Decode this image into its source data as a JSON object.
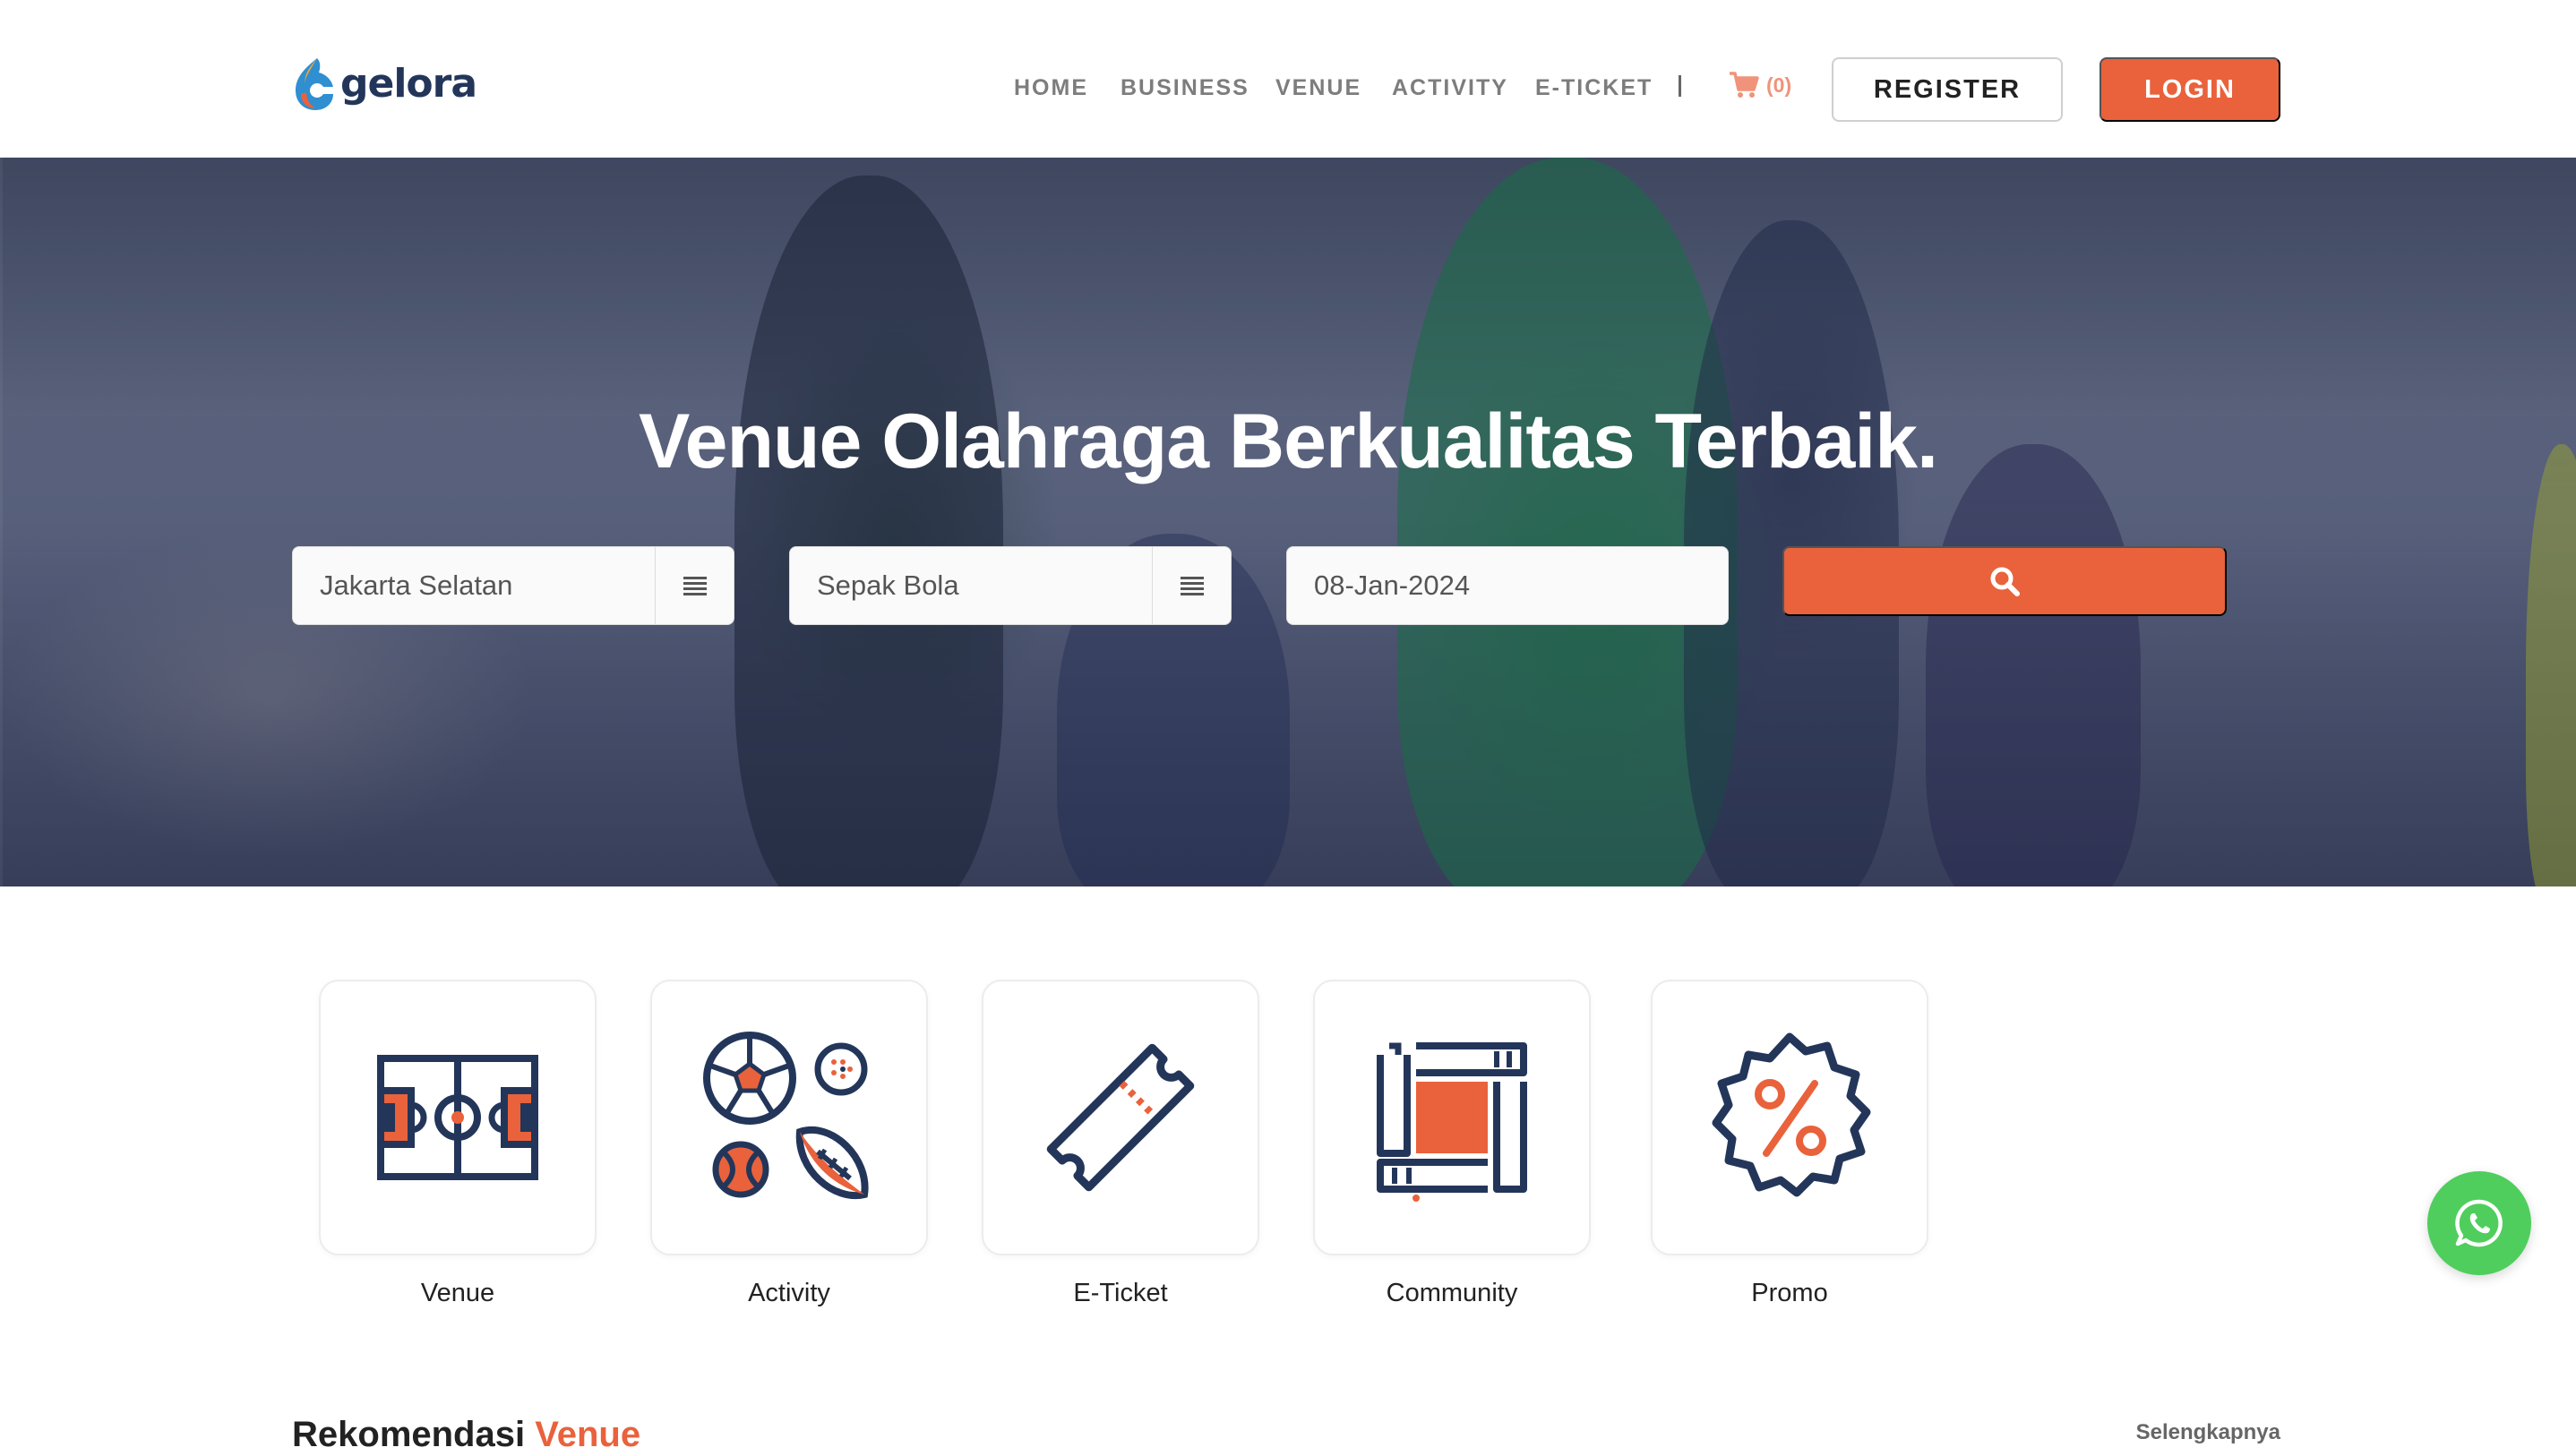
{
  "brand": {
    "name": "gelora",
    "accent": "#e9623c",
    "navy": "#23365a"
  },
  "nav": {
    "items": [
      "HOME",
      "BUSINESS",
      "VENUE",
      "ACTIVITY",
      "E-TICKET"
    ],
    "cart_count": "(0)",
    "cart_icon": "shopping-cart-icon",
    "register_label": "REGISTER",
    "login_label": "LOGIN"
  },
  "hero": {
    "title": "Venue Olahraga Berkualitas Terbaik.",
    "location_value": "Jakarta Selatan",
    "sport_value": "Sepak Bola",
    "date_value": "08-Jan-2024",
    "search_icon": "search-icon"
  },
  "categories": [
    {
      "label": "Venue",
      "icon": "soccer-field-icon"
    },
    {
      "label": "Activity",
      "icon": "sports-balls-icon"
    },
    {
      "label": "E-Ticket",
      "icon": "ticket-icon"
    },
    {
      "label": "Community",
      "icon": "community-hands-icon"
    },
    {
      "label": "Promo",
      "icon": "promo-badge-icon"
    }
  ],
  "recommendation": {
    "title_prefix": "Rekomendasi",
    "title_accent": "Venue",
    "more_label": "Selengkapnya"
  },
  "whatsapp": {
    "icon": "whatsapp-icon"
  }
}
